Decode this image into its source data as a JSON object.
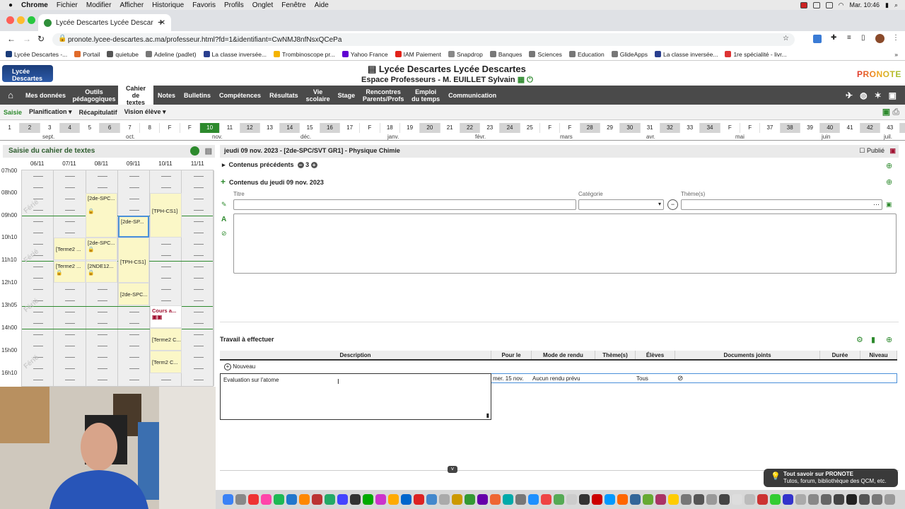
{
  "mac_menubar": {
    "items": [
      "Chrome",
      "Fichier",
      "Modifier",
      "Afficher",
      "Historique",
      "Favoris",
      "Profils",
      "Onglet",
      "Fenêtre",
      "Aide"
    ],
    "clock": "Mar. 10:46"
  },
  "browser": {
    "tab_title": "Lycée Descartes Lycée Descar",
    "url": "pronote.lycee-descartes.ac.ma/professeur.html?fd=1&identifiant=CwNMJ8nfNsxQCePa",
    "bookmarks": [
      "Lycée Descartes -...",
      "Portail",
      "quietube",
      "Adeline (padlet)",
      "La classe inversée...",
      "Trombinoscope pr...",
      "Yahoo France",
      "IAM Paiement",
      "Snapdrop",
      "Banques",
      "Sciences",
      "Education",
      "GlideApps",
      "La classe inversée...",
      "1re spécialité - livr..."
    ]
  },
  "header": {
    "logo_text": "Lycée Descartes",
    "title": "Lycée Descartes Lycée Descartes",
    "subtitle": "Espace Professeurs - M. EUILLET Sylvain",
    "brand": "PRONOTE"
  },
  "nav": {
    "items": [
      "Mes données",
      "Outils pédagogiques",
      "Cahier de textes",
      "Notes",
      "Bulletins",
      "Compétences",
      "Résultats",
      "Vie scolaire",
      "Stage",
      "Rencontres Parents/Profs",
      "Emploi du temps",
      "Communication"
    ],
    "active": "Cahier de textes"
  },
  "subnav": {
    "items": [
      "Saisie",
      "Planification",
      "Récapitulatif",
      "Vision élève"
    ],
    "active": "Saisie"
  },
  "timeline": {
    "weeks": [
      "1",
      "2",
      "3",
      "4",
      "5",
      "6",
      "7",
      "8",
      "F",
      "F",
      "10",
      "11",
      "12",
      "13",
      "14",
      "15",
      "16",
      "17",
      "F",
      "18",
      "19",
      "20",
      "21",
      "22",
      "23",
      "24",
      "25",
      "F",
      "F",
      "28",
      "29",
      "30",
      "31",
      "32",
      "33",
      "34",
      "F",
      "F",
      "37",
      "38",
      "39",
      "40",
      "41",
      "42",
      "43",
      "44",
      "F"
    ],
    "current_week": "10",
    "months": [
      "sept.",
      "oct.",
      "nov.",
      "déc.",
      "janv.",
      "févr.",
      "mars",
      "avr.",
      "mai",
      "juin",
      "juil."
    ]
  },
  "left_panel": {
    "title": "Saisie du cahier de textes",
    "days": [
      "06/11",
      "07/11",
      "08/11",
      "09/11",
      "10/11",
      "11/11"
    ],
    "hours": [
      "07h00",
      "08h00",
      "09h00",
      "10h10",
      "11h10",
      "12h10",
      "13h05",
      "14h00",
      "15h00",
      "16h10"
    ],
    "ferie": "Férié",
    "events": [
      "[2de-SPC...",
      "[2de-SP...",
      "[TPH-CS1]",
      "[Terme2 ...",
      "[2de-SPC...",
      "[TPH-CS1]",
      "[Terme2 ...",
      "[2NDE12...",
      "[2de-SPC...",
      "Cours a...",
      "[Terme2 C...",
      "[Term2 C..."
    ]
  },
  "editor": {
    "header": "jeudi 09 nov. 2023 - [2de-SPC/SVT GR1] - Physique Chimie",
    "published": "Publié",
    "previous_label": "Contenus précédents",
    "previous_count": "3",
    "contents_label": "Contenus du jeudi 09 nov. 2023",
    "title_label": "Titre",
    "category_label": "Catégorie",
    "themes_label": "Thème(s)"
  },
  "travail": {
    "label": "Travail à effectuer",
    "columns": [
      "Description",
      "Pour le",
      "Mode de rendu",
      "Thème(s)",
      "Élèves",
      "Documents joints",
      "Durée",
      "Niveau"
    ],
    "new_label": "Nouveau",
    "row": {
      "description": "Evaluation sur l'atome",
      "pour_le": "mer. 15 nov.",
      "mode": "Aucun rendu prévu",
      "eleves": "Tous"
    }
  },
  "tip": {
    "title": "Tout savoir sur PRONOTE",
    "subtitle": "Tutos, forum, bibliothèque des QCM, etc."
  }
}
